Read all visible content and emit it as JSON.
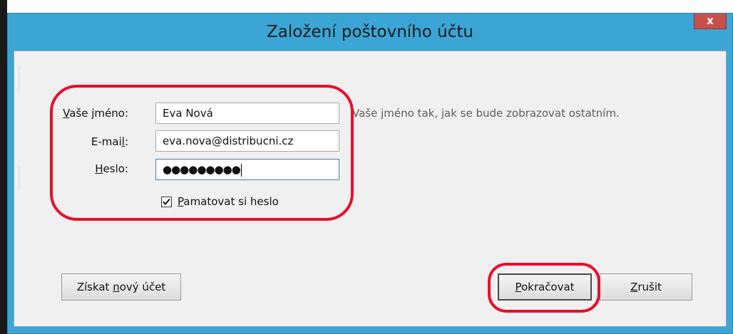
{
  "window": {
    "title": "Založení poštovního účtu",
    "close_label": "x"
  },
  "form": {
    "name_label_prefix": "V",
    "name_label_rest": "aše jméno:",
    "name_value": "Eva Nová",
    "name_hint": "Vaše jméno tak, jak se bude zobrazovat ostatním.",
    "email_label_prefix": "E-mai",
    "email_label_underlined": "l",
    "email_label_suffix": ":",
    "email_value": "eva.nova@distribucni.cz",
    "password_label_prefix": "H",
    "password_label_rest": "eslo:",
    "password_masked": "●●●●●●●●●",
    "remember_checked": true,
    "remember_label_prefix": "P",
    "remember_label_rest": "amatovat si heslo"
  },
  "buttons": {
    "new_account_prefix": "Získat ",
    "new_account_underlined": "n",
    "new_account_suffix": "ový účet",
    "continue_prefix": "P",
    "continue_rest": "okračovat",
    "cancel_prefix": "Z",
    "cancel_rest": "rušit"
  },
  "colors": {
    "window_frame": "#3ba6d6",
    "close_button": "#c7504b",
    "annotation": "#e8102a",
    "client_background": "#f0f0f0"
  }
}
